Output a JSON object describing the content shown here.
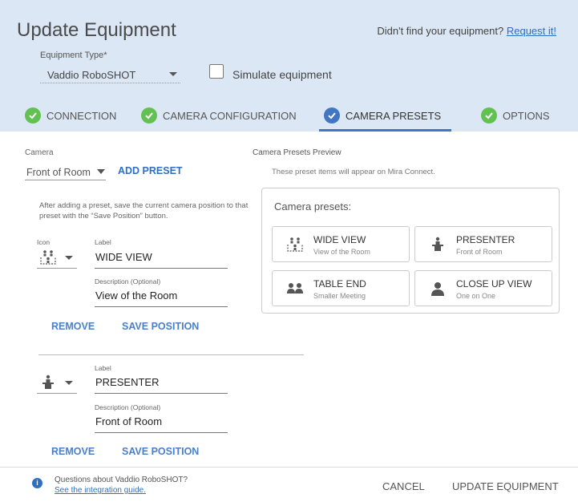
{
  "header": {
    "title": "Update Equipment",
    "didnt_find_text": "Didn't find your equipment?",
    "request_link": "Request it!",
    "equipment_type_label": "Equipment Type*",
    "equipment_type_value": "Vaddio RoboSHOT",
    "simulate_label": "Simulate equipment",
    "simulate_checked": false
  },
  "tabs": [
    {
      "label": "CONNECTION",
      "state": "complete",
      "icon": "check-circle-green"
    },
    {
      "label": "CAMERA CONFIGURATION",
      "state": "complete",
      "icon": "check-circle-green"
    },
    {
      "label": "CAMERA PRESETS",
      "state": "active",
      "icon": "check-circle-blue"
    },
    {
      "label": "OPTIONS",
      "state": "complete",
      "icon": "check-circle-green"
    }
  ],
  "left": {
    "camera_label": "Camera",
    "camera_value": "Front of Room",
    "add_preset": "ADD PRESET",
    "help_text": "After adding a preset, save the current camera position to that preset with the “Save Position” button."
  },
  "presets": [
    {
      "icon_label": "Icon",
      "icon": "classroom-icon",
      "label_caption": "Label",
      "label": "WIDE VIEW",
      "desc_caption": "Description (Optional)",
      "description": "View of the Room",
      "remove": "REMOVE",
      "save": "SAVE POSITION"
    },
    {
      "icon": "presenter-icon",
      "label_caption": "Label",
      "label": "PRESENTER",
      "desc_caption": "Description (Optional)",
      "description": "Front of Room",
      "remove": "REMOVE",
      "save": "SAVE POSITION"
    }
  ],
  "preview": {
    "title": "Camera Presets Preview",
    "subtitle": "These preset items will appear on Mira  Connect.",
    "header": "Camera presets:",
    "buttons": [
      {
        "label": "WIDE VIEW",
        "desc": "View of the Room",
        "icon": "classroom-icon"
      },
      {
        "label": "PRESENTER",
        "desc": "Front of Room",
        "icon": "presenter-icon"
      },
      {
        "label": "TABLE END",
        "desc": "Smaller Meeting",
        "icon": "two-people-icon"
      },
      {
        "label": "CLOSE UP VIEW",
        "desc": "One on One",
        "icon": "person-icon"
      }
    ]
  },
  "footer": {
    "question": "Questions about Vaddio RoboSHOT?",
    "guide_link": "See the integration guide.",
    "cancel": "CANCEL",
    "update": "UPDATE EQUIPMENT"
  },
  "colors": {
    "header_bg": "#dbe7f4",
    "accent_blue": "#2e6fc3",
    "check_green": "#62c152",
    "active_check": "#4276c2"
  }
}
